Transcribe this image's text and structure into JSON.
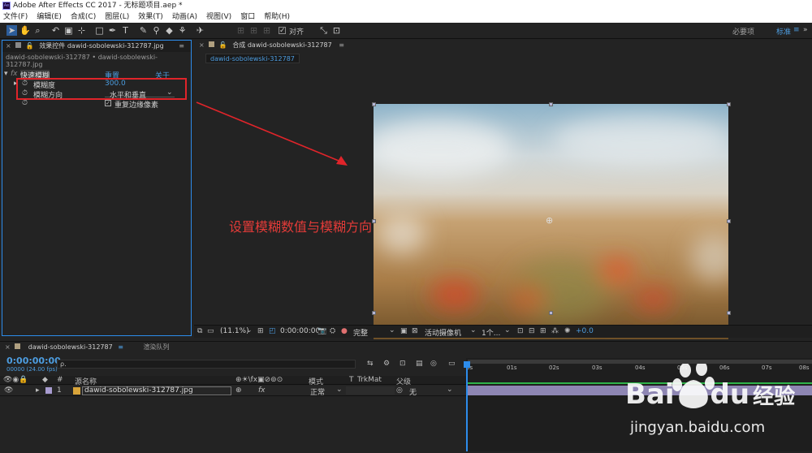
{
  "window": {
    "title": "Adobe After Effects CC 2017 - 无标题项目.aep *",
    "logo": "Ae"
  },
  "menu": [
    "文件(F)",
    "编辑(E)",
    "合成(C)",
    "图层(L)",
    "效果(T)",
    "动画(A)",
    "视图(V)",
    "窗口",
    "帮助(H)"
  ],
  "toolbar": {
    "snap_label": "对齐",
    "workspace_default": "必要项",
    "workspace_standard": "标准",
    "menu_icon": "≡",
    "more_icon": "»"
  },
  "effects_panel": {
    "tab_label": "效果控件 dawid-sobolewski-312787.jpg",
    "breadcrumb": "dawid-sobolewski-312787 • dawid-sobolewski-312787.jpg",
    "effect": {
      "name": "快速模糊",
      "reset": "重置",
      "about": "关于"
    },
    "props": [
      {
        "label": "模糊度",
        "value": "300.0"
      },
      {
        "label": "模糊方向",
        "value": "水平和垂直"
      },
      {
        "label": "",
        "value": "重复边缘像素"
      }
    ]
  },
  "comp_panel": {
    "tab_label": "合成 dawid-sobolewski-312787",
    "subtab": "dawid-sobolewski-312787"
  },
  "comp_footer": {
    "zoom": "(11.1%)",
    "timecode": "0:00:00:00",
    "resolution": "完整",
    "camera": "活动摄像机",
    "views": "1个...",
    "exposure": "+0.0"
  },
  "timeline": {
    "tab_label": "dawid-sobolewski-312787",
    "render_queue": "渲染队列",
    "menu_icon": "≡",
    "timecode": "0:00:00:00",
    "frame_info": "00000 (24.00 fps)",
    "search_placeholder": "ρ.",
    "columns": {
      "num": "#",
      "source": "源名称",
      "mode": "模式",
      "t": "T",
      "trkmat": "TrkMat",
      "parent": "父级"
    },
    "switch_labels": {
      "shy": "⊕",
      "fx": "fx"
    },
    "layer": {
      "index": "1",
      "name": "dawid-sobolewski-312787.jpg",
      "mode": "正常",
      "parent": "无"
    },
    "ruler": [
      "0s",
      "01s",
      "02s",
      "03s",
      "04s",
      "05s",
      "06s",
      "07s",
      "08s"
    ]
  },
  "annotation": {
    "text": "设置模糊数值与模糊方向",
    "color": "#e23b38"
  },
  "watermark": {
    "brand": "Bai",
    "brand2": "du",
    "suffix": "经验",
    "url": "jingyan.baidu.com"
  }
}
